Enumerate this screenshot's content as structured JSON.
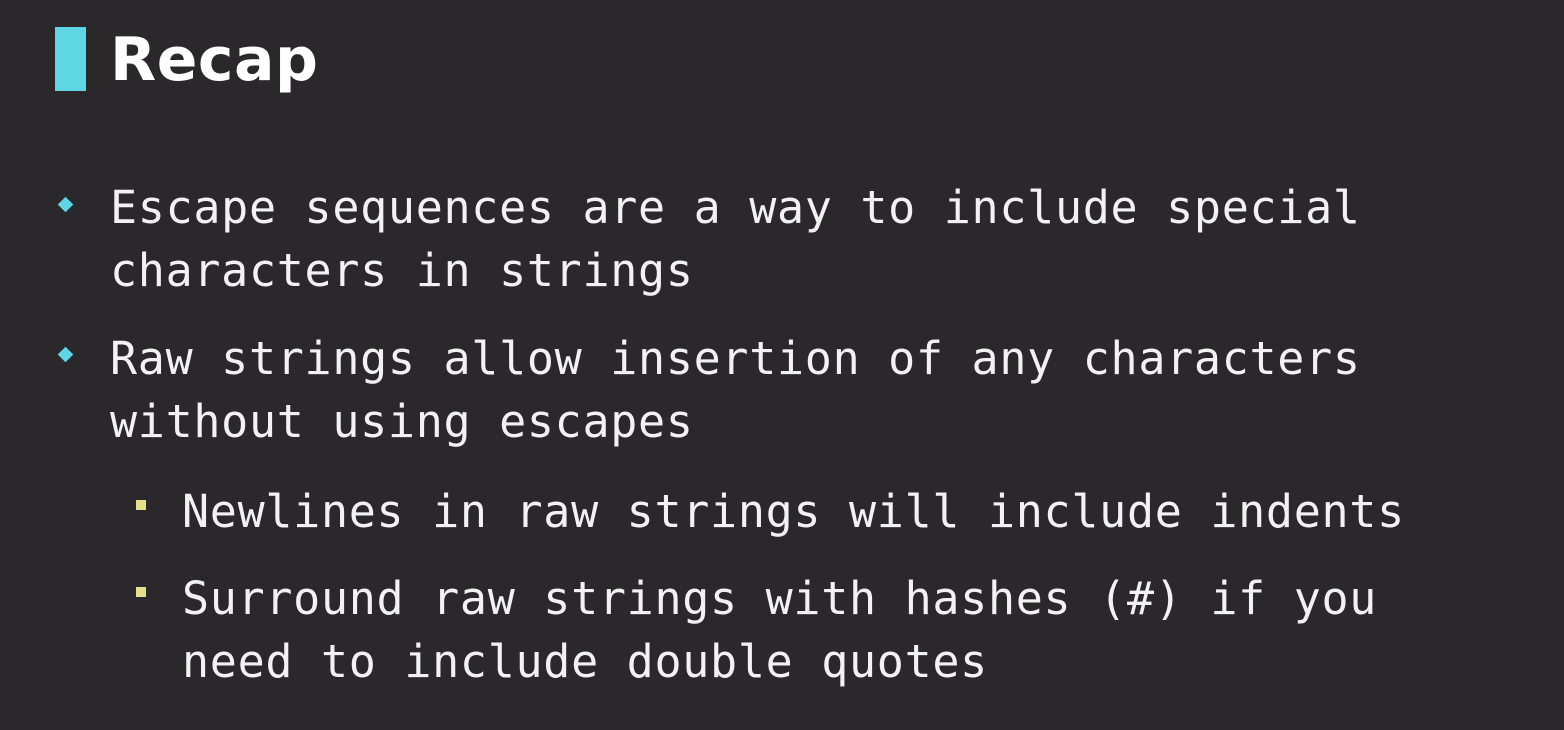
{
  "title": "Recap",
  "bullets": [
    {
      "lines": [
        "Escape sequences are a way to include special",
        "characters in strings"
      ]
    },
    {
      "lines": [
        "Raw strings allow insertion of any characters",
        "without using escapes"
      ]
    },
    {
      "lines": [
        "Newlines in raw strings will include indents"
      ]
    },
    {
      "lines": [
        "Surround raw strings with hashes (#) if you",
        "need to include double quotes"
      ]
    }
  ],
  "colors": {
    "background": "#2a282b",
    "accent": "#5fd6e3",
    "sub_bullet": "#e5e08a",
    "text": "#f2f2f2"
  }
}
